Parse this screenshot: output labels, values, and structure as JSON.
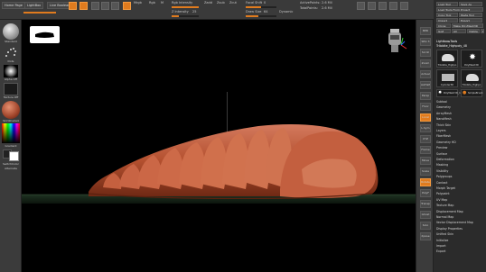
{
  "top_toolbar": {
    "home_page": "Home Page",
    "lightbox": "LightBox",
    "live_boolean": "Live Boolean",
    "mrgb": "Mrgb",
    "rgb": "Rgb",
    "m": "M",
    "zadd": "Zadd",
    "zsub": "Zsub",
    "zcut": "Zcut",
    "focal_shift_label": "Focal Shift",
    "focal_shift_value": "0",
    "draw_size_label": "Draw Size",
    "draw_size_value": "64",
    "dynamic": "Dynamic",
    "active_points_label": "ActivePoints:",
    "active_points_value": "2.6 Mil",
    "total_points_label": "TotalPoints:",
    "total_points_value": "2.6 Mil",
    "rgb_intensity_label": "Rgb Intensity",
    "z_intensity_label": "Z Intensity",
    "z_intensity_value": "25",
    "rgb_fill": 1.0,
    "z_fill": 0.25,
    "accent_color": "#e07b1e"
  },
  "left_shelf": {
    "brush_label": "Standard",
    "stroke_label": "Dots",
    "alpha_label": "Alpha Off",
    "texture_label": "Texture Off",
    "material_label": "SkinShade4",
    "gradient_label": "Gradient",
    "switch_color_label": "SwitchColor",
    "alternate_label": "Alternate"
  },
  "right_shelf": {
    "buttons": [
      "BPR",
      "SPix 3",
      "Scroll",
      "Zoom",
      "Actual",
      "AAHalf",
      "Persp",
      "Floor",
      "Local",
      "L.Sym",
      "XYZ",
      "Frame",
      "Move",
      "Scale",
      "Rotate",
      "PolyF",
      "Transp",
      "Ghost",
      "Solo",
      "Xpose"
    ]
  },
  "tool_palette": {
    "header_rows": [
      "Load Tool",
      "Save As",
      "Load Tools From Project",
      "Copy Tool",
      "Paste Tool",
      "Import",
      "Export",
      "Clone",
      "Make PolyMesh3D",
      "GoZ",
      "All",
      "Visible",
      "R"
    ],
    "lightbox_tools": "Lightbox▸Tools",
    "current_tool": "Trilobite_Highpoly_48",
    "thumbnails": [
      {
        "label": "Trilobite_Highpo",
        "icon": "trilobite-thumb-icon"
      },
      {
        "label": "PolyMesh3D",
        "icon": "star-thumb-icon"
      },
      {
        "label": "Cylinder3D",
        "icon": "cylinder-thumb-icon"
      },
      {
        "label": "Trilobite_Highpo",
        "icon": "trilobite-thumb-icon"
      },
      {
        "label": "PolyMesh3D_1",
        "icon": "star-thumb-icon"
      },
      {
        "label": "SimpleBrush",
        "icon": "brush-thumb-icon"
      }
    ],
    "subtool_rows": [
      "Subtool",
      "Geometry",
      "ArrayMesh",
      "NanoMesh",
      "Thick Skin",
      "Layers",
      "FiberMesh",
      "Geometry HD",
      "Preview",
      "Surface",
      "Deformation",
      "Masking",
      "Visibility",
      "Polygroups",
      "Contact",
      "Morph Target",
      "Polypaint",
      "UV Map",
      "Texture Map",
      "Displacement Map",
      "Normal Map",
      "Vector Displacement Map",
      "Display Properties",
      "Unified Skin",
      "Initialize",
      "Import",
      "Export"
    ]
  }
}
